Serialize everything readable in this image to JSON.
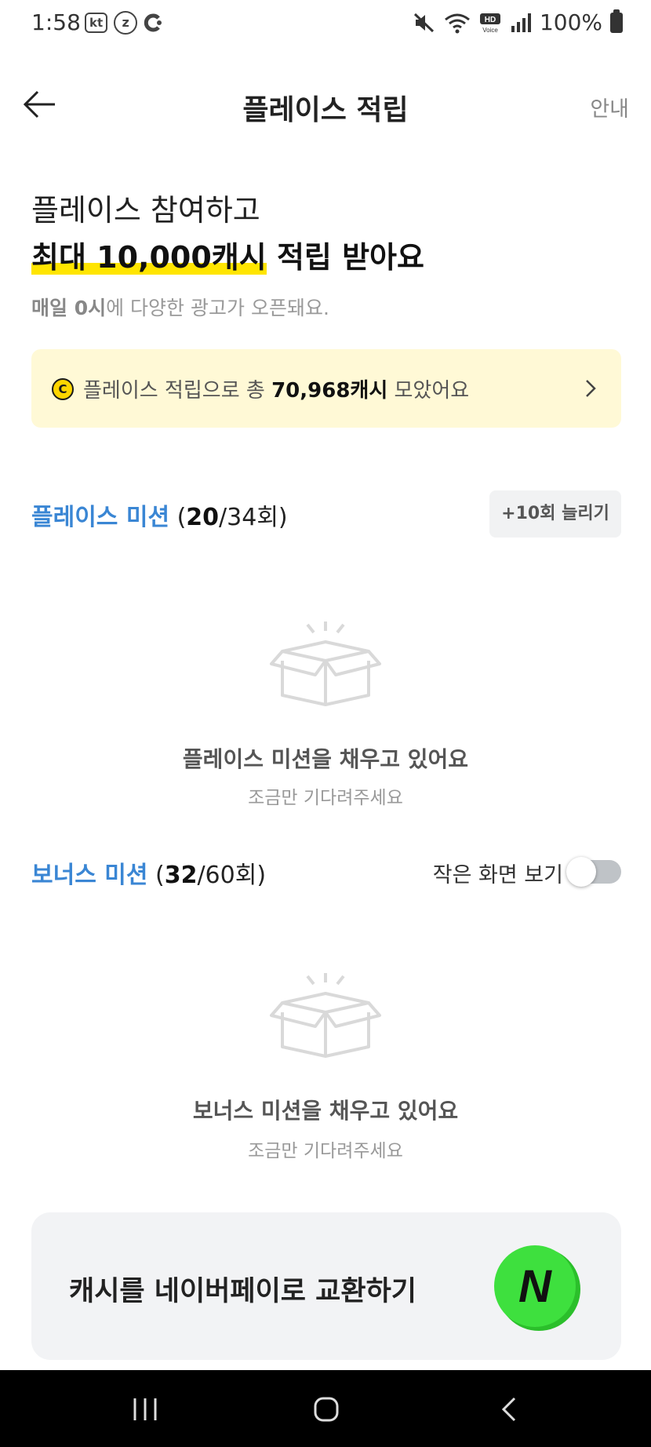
{
  "status_bar": {
    "time": "1:58",
    "carrier_badge": "kt",
    "app_badge": "z",
    "battery": "100%",
    "icons": [
      "mute-icon",
      "wifi-icon",
      "hd-voice-icon",
      "signal-icon",
      "battery-icon"
    ]
  },
  "header": {
    "title": "플레이스 적립",
    "guide": "안내"
  },
  "hero": {
    "line1": "플레이스 참여하고",
    "highlight": "최대 10,000캐시",
    "line2_rest": " 적립 받아요",
    "sub_bold1": "매일 0시",
    "sub_rest": "에 다양한 광고가 오픈돼요."
  },
  "summary": {
    "coin": "C",
    "prefix": "플레이스 적립으로 총 ",
    "amount": "70,968캐시",
    "suffix": " 모았어요"
  },
  "place_mission": {
    "title": "플레이스 미션",
    "open": " (",
    "current": "20",
    "total": "/34회)",
    "add_button": "+10회 늘리기",
    "empty_title": "플레이스 미션을 채우고 있어요",
    "empty_sub": "조금만 기다려주세요"
  },
  "bonus_mission": {
    "title": "보너스 미션",
    "open": " (",
    "current": "32",
    "total": "/60회)",
    "toggle_label": "작은 화면 보기",
    "toggle_on": false,
    "empty_title": "보너스 미션을 채우고 있어요",
    "empty_sub": "조금만 기다려주세요"
  },
  "exchange": {
    "label": "캐시를 네이버페이로 교환하기",
    "logo_letter": "N"
  },
  "colors": {
    "accent_blue": "#3a86d4",
    "highlight_yellow": "#ffe500",
    "banner_bg": "#fff9d6",
    "naver_green": "#3ee03e"
  }
}
